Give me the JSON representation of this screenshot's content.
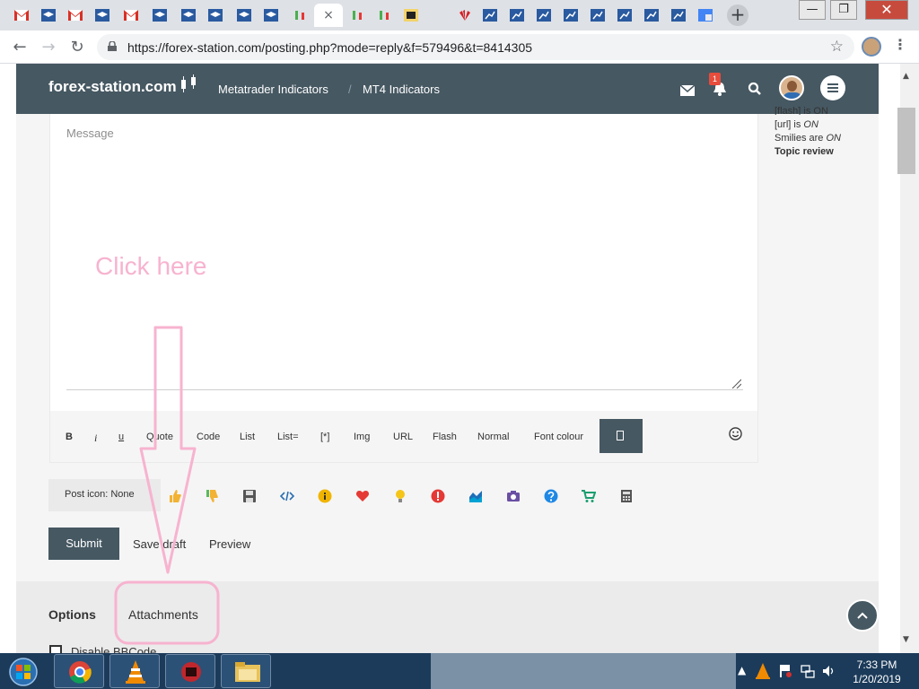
{
  "browser": {
    "url": "https://forex-station.com/posting.php?mode=reply&f=579496&t=8414305",
    "active_tab_close": "×",
    "new_tab": "+",
    "window_controls": {
      "minimize": "—",
      "maximize": "❐",
      "close": "✕"
    }
  },
  "site": {
    "logo": "forex-station.com",
    "breadcrumbs": [
      "Metatrader Indicators",
      "MT4 Indicators"
    ],
    "notification_count": "1"
  },
  "editor": {
    "message_placeholder": "Message",
    "format_buttons": [
      "B",
      "i",
      "u",
      "Quote",
      "Code",
      "List",
      "List=",
      "[*]",
      "Img",
      "URL",
      "Flash",
      "Normal",
      "Font colour"
    ]
  },
  "sidebar": {
    "flash_status": "[flash] is ON",
    "url_status_prefix": "[url] is ",
    "url_status_value": "ON",
    "smilies_status_prefix": "Smilies are ",
    "smilies_status_value": "ON",
    "topic_review": "Topic review"
  },
  "post_icon": {
    "label": "Post icon: None",
    "icons": [
      "thumbs-up-icon",
      "thumbs-down-icon",
      "floppy-disk-icon",
      "code-icon",
      "info-icon",
      "heart-icon",
      "lightbulb-icon",
      "exclamation-icon",
      "area-chart-icon",
      "camera-icon",
      "question-icon",
      "shopping-cart-icon",
      "calculator-icon"
    ]
  },
  "actions": {
    "submit": "Submit",
    "save_draft": "Save draft",
    "preview": "Preview"
  },
  "options": {
    "tabs": [
      "Options",
      "Attachments"
    ],
    "disable_bbcode": "Disable BBCode"
  },
  "annotation": {
    "text": "Click here"
  },
  "taskbar": {
    "time": "7:33 PM",
    "date": "1/20/2019"
  },
  "colors": {
    "header": "#465862",
    "annotation_pink": "#f7b3cf",
    "page_bg": "#f5f5f5"
  }
}
